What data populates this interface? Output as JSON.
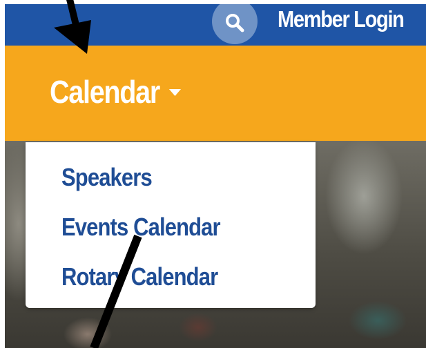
{
  "header": {
    "search_icon": "search-icon",
    "member_login_label": "Member Login"
  },
  "nav": {
    "calendar_label": "Calendar",
    "caret_icon": "caret-down-icon"
  },
  "dropdown": {
    "items": [
      {
        "label": "Speakers"
      },
      {
        "label": "Events Calendar"
      },
      {
        "label": "Rotary Calendar"
      }
    ]
  },
  "colors": {
    "topbar": "#1f55a6",
    "navbar": "#f6a71c",
    "dropdown_text": "#1f4d95",
    "annotation_arrow": "#000000"
  }
}
